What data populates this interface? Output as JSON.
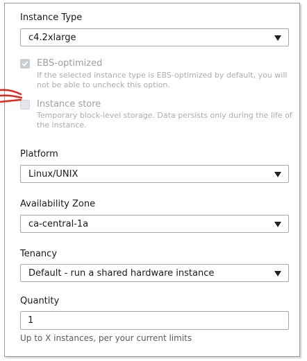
{
  "instance_type": {
    "label": "Instance Type",
    "selected": "c4.2xlarge"
  },
  "ebs_optimized": {
    "label": "EBS-optimized",
    "checked": true,
    "disabled": true,
    "description": "If the selected instance type is EBS-optimized by default, you will not be able to uncheck this option."
  },
  "instance_store": {
    "label": "Instance store",
    "checked": false,
    "disabled": true,
    "description": "Temporary block-level storage. Data persists only during the life of the instance."
  },
  "platform": {
    "label": "Platform",
    "selected": "Linux/UNIX"
  },
  "availability_zone": {
    "label": "Availability Zone",
    "selected": "ca-central-1a"
  },
  "tenancy": {
    "label": "Tenancy",
    "selected": "Default - run a shared hardware instance"
  },
  "quantity": {
    "label": "Quantity",
    "value": "1",
    "hint": "Up to X instances, per your current limits"
  },
  "colors": {
    "annotation_red": "#e8231c",
    "border": "#a8a8a8",
    "disabled_text": "#9aa0a6"
  }
}
